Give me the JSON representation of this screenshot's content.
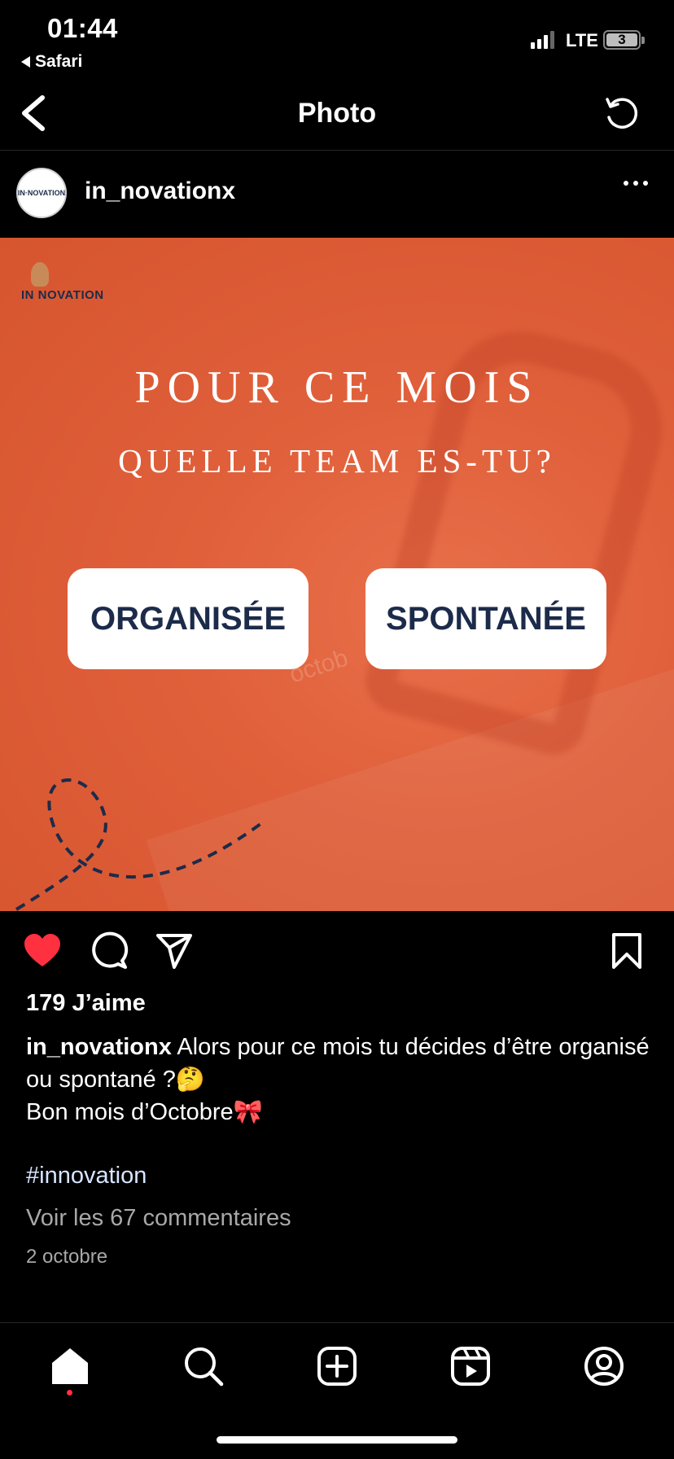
{
  "status_bar": {
    "time": "01:44",
    "back_app": "Safari",
    "network": "LTE",
    "battery": "3"
  },
  "nav": {
    "title": "Photo"
  },
  "post": {
    "username": "in_novationx",
    "image": {
      "brand": "IN NOVATION",
      "headline1": "POUR CE MOIS",
      "headline2": "QUELLE TEAM ES-TU?",
      "choice_left": "ORGANISÉE",
      "choice_right": "SPONTANÉE",
      "background_text": "octob",
      "accent_color": "#e0603b",
      "button_text_color": "#1c2b4a"
    },
    "liked": true,
    "likes_label": "179 J’aime",
    "caption_user": "in_novationx",
    "caption_text": " Alors pour ce mois tu décides d’être organisé ou spontané ?🤔",
    "caption_line2": "Bon mois d’Octobre🎀",
    "hashtag": "#innovation",
    "comments_link": "Voir les 67 commentaires",
    "date": "2 octobre"
  },
  "icons": {
    "like": "heart-icon",
    "comment": "comment-icon",
    "share": "paper-plane-icon",
    "save": "bookmark-icon"
  },
  "tabbar": {
    "items": [
      "home",
      "search",
      "create",
      "reels",
      "profile"
    ],
    "active": "home"
  }
}
